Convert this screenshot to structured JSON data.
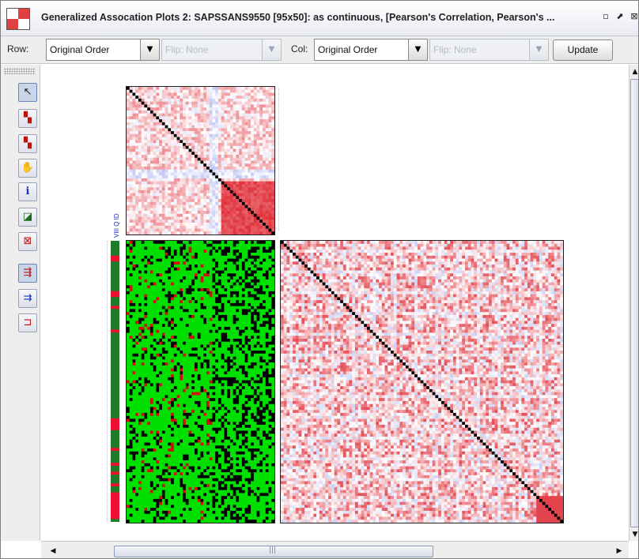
{
  "window": {
    "title": "Generalized Assocation Plots 2: SAPSSANS9550 [95x50]: as continuous, [Pearson's Correlation, Pearson's ...",
    "buttons": [
      "minimize-icon",
      "maximize-icon",
      "close-icon"
    ]
  },
  "toolbar": {
    "row_label": "Row:",
    "row_order": "Original Order",
    "row_flip": "Flip: None",
    "col_label": "Col:",
    "col_order": "Original Order",
    "col_flip": "Flip: None",
    "update_label": "Update"
  },
  "tools": [
    {
      "icon": "pointer-icon",
      "glyph": "↖"
    },
    {
      "icon": "row-proximity-icon",
      "glyph": "▚"
    },
    {
      "icon": "column-proximity-icon",
      "glyph": "▚"
    },
    {
      "icon": "hand-pan-icon",
      "glyph": "✋"
    },
    {
      "icon": "info-icon",
      "glyph": "ℹ"
    },
    {
      "icon": "select-region-icon",
      "glyph": "◪"
    },
    {
      "icon": "clear-selection-icon",
      "glyph": "⊠"
    },
    {
      "icon": "sort-rows-icon",
      "glyph": "⇶"
    },
    {
      "icon": "sort-columns-icon",
      "glyph": "⇉"
    },
    {
      "icon": "split-icon",
      "glyph": "⊐"
    }
  ],
  "plot": {
    "side_axis_label": "VIII Q ID",
    "colors": {
      "correlation_positive": "#e0303a",
      "correlation_negative": "#4a60e0",
      "data_high": "#00e000",
      "data_low": "#000000",
      "data_missing": "#d01010",
      "diagonal": "#000000",
      "sidebar_primary": "#1f7a2a",
      "sidebar_secondary": "#ee1030"
    }
  }
}
